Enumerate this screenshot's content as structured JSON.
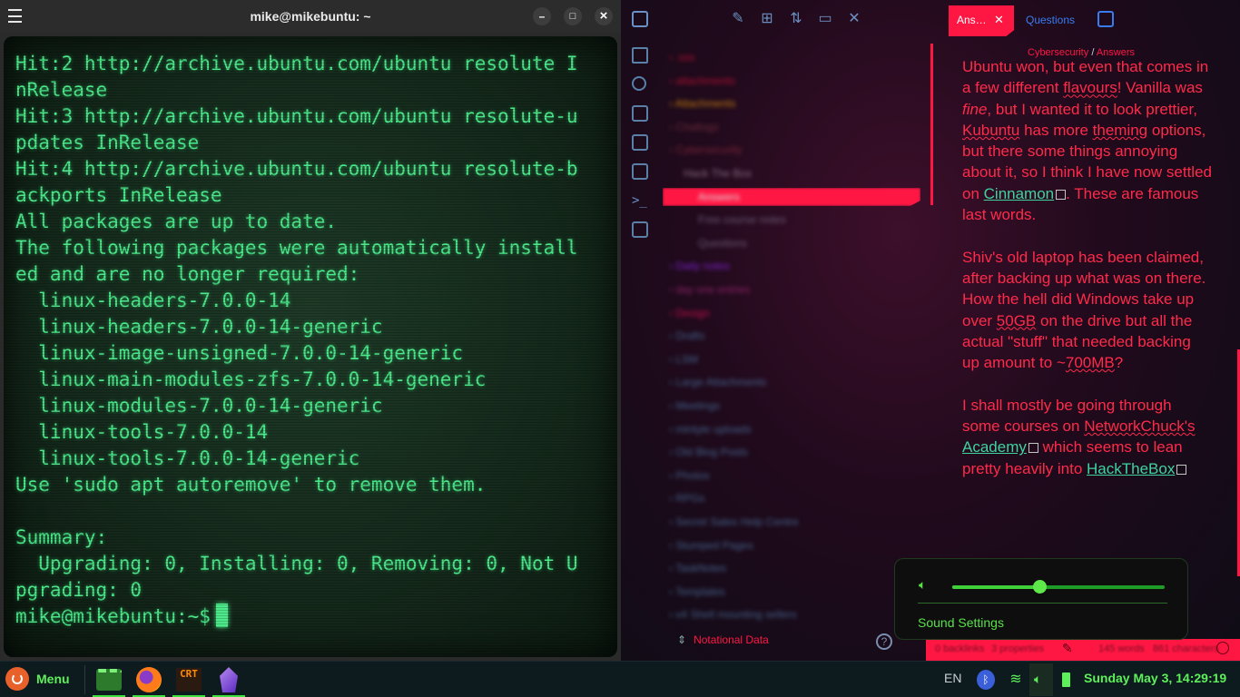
{
  "terminal": {
    "title": "mike@mikebuntu: ~",
    "buttons": {
      "minimize": "–",
      "maximize": "□",
      "close": "×"
    },
    "lines": [
      "Hit:2 http://archive.ubuntu.com/ubuntu resolute I",
      "nRelease",
      "Hit:3 http://archive.ubuntu.com/ubuntu resolute-u",
      "pdates InRelease",
      "Hit:4 http://archive.ubuntu.com/ubuntu resolute-b",
      "ackports InRelease",
      "All packages are up to date.",
      "The following packages were automatically install",
      "ed and are no longer required:",
      "  linux-headers-7.0.0-14",
      "  linux-headers-7.0.0-14-generic",
      "  linux-image-unsigned-7.0.0-14-generic",
      "  linux-main-modules-zfs-7.0.0-14-generic",
      "  linux-modules-7.0.0-14-generic",
      "  linux-tools-7.0.0-14",
      "  linux-tools-7.0.0-14-generic",
      "Use 'sudo apt autoremove' to remove them.",
      "",
      "Summary:",
      "  Upgrading: 0, Installing: 0, Removing: 0, Not U",
      "pgrading: 0"
    ],
    "prompt": "mike@mikebuntu:~$"
  },
  "obsidian": {
    "tree": [
      ".sss",
      "attachments",
      "Attachments",
      "Chatlogs",
      "Cybersecurity",
      "Hack The Box",
      "Answers",
      "Free course notes",
      "Questions",
      "Daily notes",
      "day one entries",
      "Design",
      "Drafts",
      "LSM",
      "Large Attachments",
      "Meetings",
      "mintyle uploads",
      "Old Blog Posts",
      "Photos",
      "RPGs",
      "Secret Sales Help Centre",
      "Stumped Pages",
      "TaskNotes",
      "Templates",
      "v4 Shell mounting sellers"
    ],
    "tree_colors": [
      "#b01030",
      "#b01030",
      "#c07a10",
      "#6a2a3a",
      "#7a2436",
      "#8a6b80",
      "#e0e0e0",
      "#6b5a78",
      "#6b5a78",
      "#7a22c8",
      "#8a2266",
      "#c0104a",
      "#44608a",
      "#44608a",
      "#44608a",
      "#44608a",
      "#44608a",
      "#44608a",
      "#44608a",
      "#44608a",
      "#44608a",
      "#44608a",
      "#44608a",
      "#44608a",
      "#44608a"
    ],
    "notational_label": "Notational Data",
    "tabs": {
      "active": "Ans…",
      "close": "✕",
      "other": "Questions"
    },
    "breadcrumb": {
      "parent": "Cybersecurity",
      "sep": "/",
      "current": "Answers"
    },
    "content": {
      "p1_a": "Ubuntu won, but even that comes in a few different ",
      "p1_flavours": "flavours",
      "p1_b": "! Vanilla was ",
      "p1_fine": "fine",
      "p1_c": ", but I wanted it to look prettier, ",
      "p1_kubuntu": "Kubuntu",
      "p1_d": " has more ",
      "p1_theming": "theming",
      "p1_e": " options, but there some things annoying about it, so I think I have now settled on ",
      "p1_link": "Cinnamon",
      "p1_f": ". These are famous last words.",
      "p2_a": "Shiv's old laptop has been claimed, after backing up what was on there. How the hell did Windows take up over ",
      "p2_50gb": "50GB",
      "p2_b": " on the drive but all the actual \"stuff\" that needed backing up amount to ~",
      "p2_700mb": "700MB",
      "p2_c": "?",
      "p3_a": "I shall mostly be going through some courses on ",
      "p3_networkchuck": "NetworkChuck's",
      "p3_space": " ",
      "p3_link1": "Academy",
      "p3_b": " which seems to lean pretty heavily into ",
      "p3_link2": "HackTheBox"
    },
    "status": {
      "backlinks": "0 backlinks",
      "properties": "3 properties",
      "words": "145 words",
      "chars": "861 characters"
    }
  },
  "sound": {
    "label": "Sound Settings",
    "volume": 0.41
  },
  "taskbar": {
    "menu_label": "Menu",
    "apps": [
      "terminal",
      "firefox",
      "crt",
      "obsidian"
    ],
    "crt_text": "CRT",
    "lang": "EN",
    "clock": "Sunday May 3, 14:29:19"
  },
  "colors": {
    "terminal_text": "#4ce88a",
    "accent": "#ff1744",
    "mint_green": "#5ef05a"
  }
}
